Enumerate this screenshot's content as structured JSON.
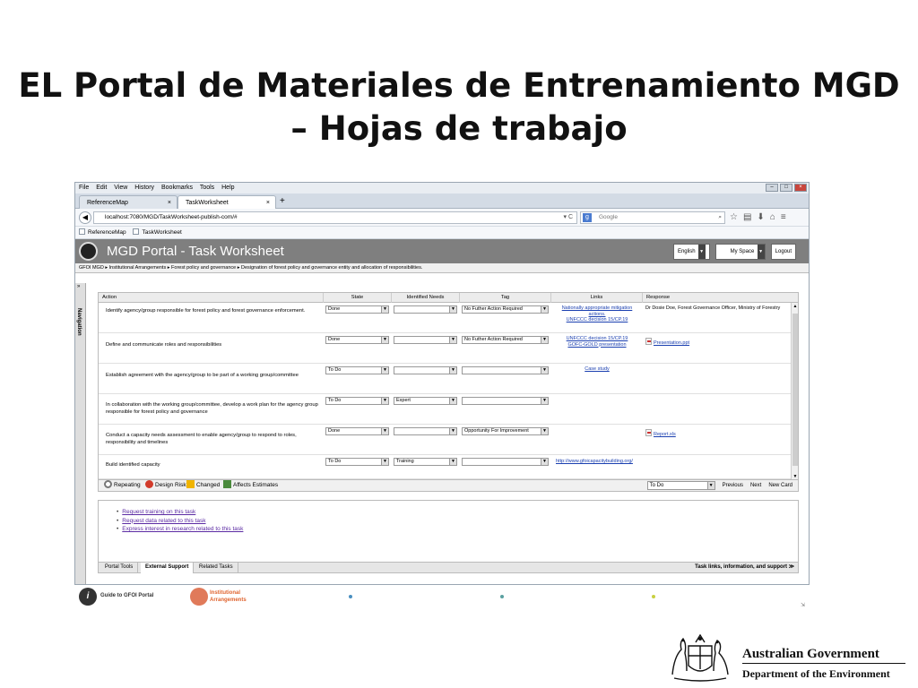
{
  "slide": {
    "title_line1": "EL Portal de Materiales de Entrenamiento MGD",
    "title_line2": "– Hojas de trabajo"
  },
  "browser": {
    "menu": [
      "File",
      "Edit",
      "View",
      "History",
      "Bookmarks",
      "Tools",
      "Help"
    ],
    "tabs": [
      {
        "label": "ReferenceMap",
        "active": false
      },
      {
        "label": "TaskWorksheet",
        "active": true
      }
    ],
    "close_glyph": "×",
    "newtab_glyph": "+",
    "url": "localhost:7080/MGD/TaskWorksheet-publish-com/#",
    "search_placeholder": "Google",
    "bookmarks": [
      "ReferenceMap",
      "TaskWorksheet"
    ]
  },
  "portal": {
    "title": "MGD Portal - Task Worksheet",
    "language": "English",
    "myspace": "My Space",
    "logout": "Logout",
    "breadcrumb": "GFOI MGD  ▸  Institutional Arrangements  ▸  Forest policy and governance  ▸  Designation of forest policy and governance entity and allocation of responsibilities.",
    "sidebar_label": "Navigation",
    "sidebar_arrow": "»"
  },
  "grid": {
    "columns": [
      "Action",
      "State",
      "Identified Needs",
      "Tag",
      "Links",
      "Response"
    ],
    "rows": [
      {
        "action": "Identify agency/group responsible for forest policy and forest governance enforcement.",
        "state": "Done",
        "needs": "",
        "tag": "No Futher Action Required",
        "links": [
          "Nationally appropriate mitigation actions.",
          "UNFCCC decision 15/CP.19"
        ],
        "response": "Dr Dosie Doe, Forest Governance Officer, Ministry of Forestry"
      },
      {
        "action": "Define and communicate roles and responsibilities",
        "state": "Done",
        "needs": "",
        "tag": "No Futher Action Required",
        "links": [
          "UNFCCC decision 15/CP.19",
          "GOFC-GOLD presentation"
        ],
        "response": "Presentation.ppt"
      },
      {
        "action": "Establish agreement with the agency/group to be part of a working group/committee",
        "state": "To Do",
        "needs": "",
        "tag": "",
        "links": [
          "Case study"
        ],
        "response": ""
      },
      {
        "action": "In collaboration with the working group/committee, develop a work plan for the agency group responsible for forest policy and governance",
        "state": "To Do",
        "needs": "Expert",
        "tag": "",
        "links": [],
        "response": ""
      },
      {
        "action": "Conduct a capacity needs assessment to enable agency/group to respond to roles, responsibility and timelines",
        "state": "Done",
        "needs": "",
        "tag": "Opportunity For Improvement",
        "links": [],
        "response": "Report.xls"
      },
      {
        "action": "Build identified capacity",
        "state": "To Do",
        "needs": "Training",
        "tag": "",
        "links": [
          "http://www.gfoicapacitybuilding.org/"
        ],
        "response": ""
      }
    ]
  },
  "legend": {
    "repeating": "Repeating",
    "design_risk": "Design Risk",
    "changed": "Changed",
    "affects": "Affects Estimates",
    "filter_value": "To Do",
    "previous": "Previous",
    "next": "Next",
    "new_card": "New Card"
  },
  "external": {
    "items": [
      "Request training on this task",
      "Request data related to this task",
      "Express interest in research related to this task"
    ],
    "tabs": [
      "Portal Tools",
      "External Support",
      "Related Tasks"
    ],
    "task_links": "Task links, information, and support"
  },
  "footer": {
    "guide": "Guide to GFOI Portal",
    "inst_line1": "Institutional",
    "inst_line2": "Arrangements",
    "i_glyph": "i"
  },
  "government": {
    "name": "Australian Government",
    "department": "Department of the Environment"
  },
  "colors": {
    "portal_header": "#7f7f7f",
    "link": "#1a3fb0",
    "inst_orange": "#e0642f"
  }
}
